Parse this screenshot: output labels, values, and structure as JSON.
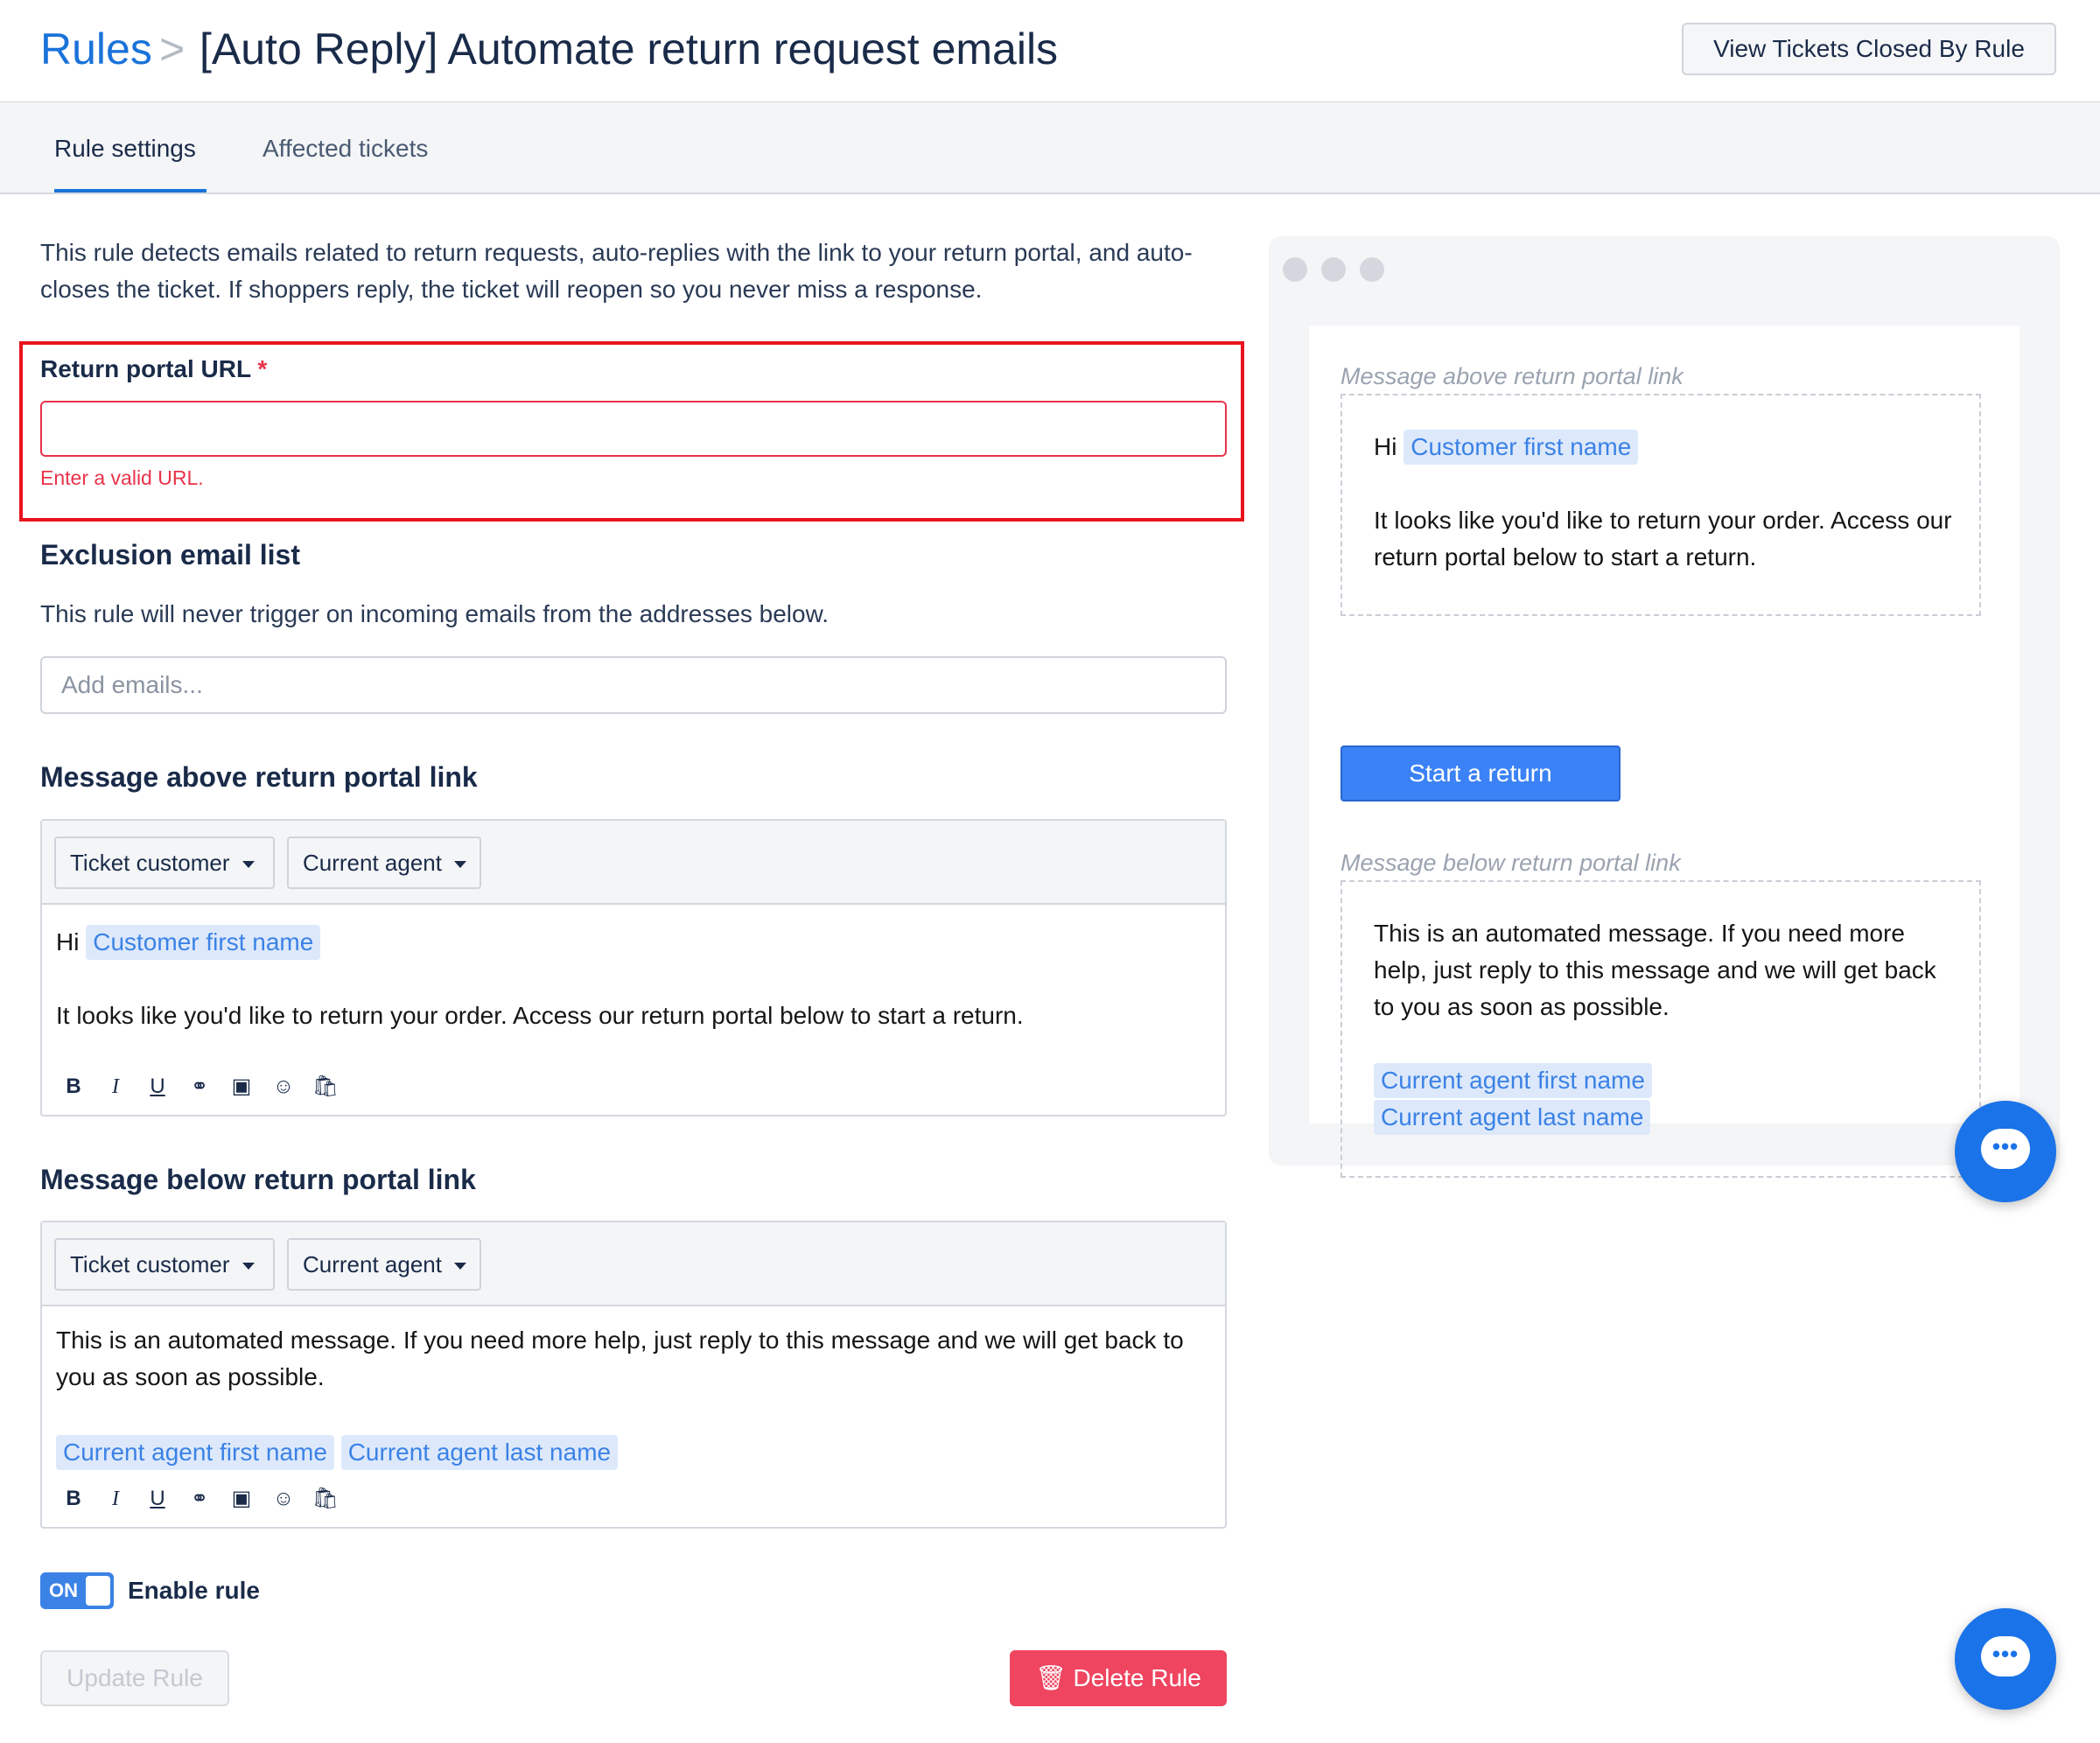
{
  "header": {
    "breadcrumb_link": "Rules",
    "breadcrumb_sep": ">",
    "title": "[Auto Reply] Automate return request emails",
    "view_button": "View Tickets Closed By Rule"
  },
  "tabs": [
    "Rule settings",
    "Affected tickets"
  ],
  "intro": "This rule detects emails related to return requests, auto-replies with the link to your return portal, and auto-closes the ticket. If shoppers reply, the ticket will reopen so you never miss a response.",
  "portal_url": {
    "label": "Return portal URL",
    "required_mark": "*",
    "value": "",
    "error": "Enter a valid URL."
  },
  "exclusion": {
    "title": "Exclusion email list",
    "description": "This rule will never trigger on incoming emails from the addresses below.",
    "placeholder": "Add emails..."
  },
  "message_above": {
    "title": "Message above return portal link",
    "dropdown_customer": "Ticket customer",
    "dropdown_agent": "Current agent",
    "greeting": "Hi",
    "chip": "Customer first name",
    "body": "It looks like you'd like to return your order. Access our return portal below to start a return."
  },
  "message_below": {
    "title": "Message below return portal link",
    "dropdown_customer": "Ticket customer",
    "dropdown_agent": "Current agent",
    "body": "This is an automated message. If you need more help, just reply to this message and we will get back to you as soon as possible.",
    "chip_first": "Current agent first name",
    "chip_last": "Current agent last name"
  },
  "format_toolbar": [
    "B",
    "I",
    "U",
    "link-icon",
    "image-icon",
    "emoji-icon",
    "shopify-icon"
  ],
  "toggle": {
    "state": "ON",
    "label": "Enable rule",
    "enabled": true
  },
  "actions": {
    "update": "Update Rule",
    "delete": "Delete Rule"
  },
  "preview": {
    "label_above": "Message above return portal link",
    "greeting": "Hi",
    "chip": "Customer first name",
    "body_above": "It looks like you'd like to return your order. Access our return portal below to start a return.",
    "button": "Start a return",
    "label_below": "Message below return portal link",
    "body_below": "This is an automated message. If you need more help, just reply to this message and we will get back to you as soon as possible.",
    "chip_first": "Current agent first name",
    "chip_last": "Current agent last name"
  },
  "colors": {
    "accent": "#1a73d9",
    "error": "#e8334a",
    "delete": "#ef4560",
    "chip_bg": "#dde9fb"
  }
}
